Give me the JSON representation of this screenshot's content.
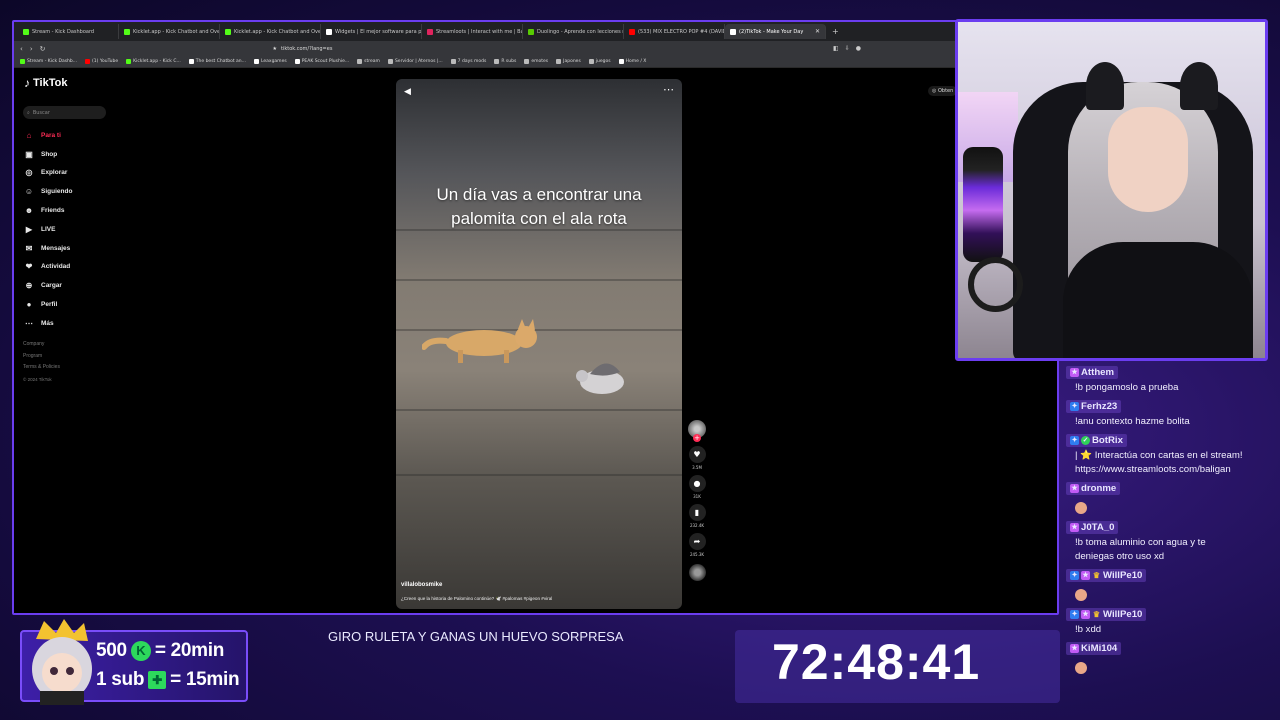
{
  "browser": {
    "tabs": [
      {
        "title": "Stream - Kick Dashboard",
        "color": "#53fc18"
      },
      {
        "title": "Kicklet.app - Kick Chatbot and Overla",
        "color": "#53fc18"
      },
      {
        "title": "Kicklet.app - Kick Chatbot and Overl",
        "color": "#53fc18"
      },
      {
        "title": "Widgets | El mejor software para por",
        "color": "#ffffff"
      },
      {
        "title": "Streamloots | Interact with me | Balig",
        "color": "#e0245e"
      },
      {
        "title": "Duolingo - Aprende con lecciones m",
        "color": "#58cc02"
      },
      {
        "title": "(533) MIX ELECTRO POP #4 (DAVID",
        "color": "#ff0000"
      },
      {
        "title": "(2)TikTok - Make Your Day",
        "color": "#ffffff"
      }
    ],
    "url": "tiktok.com/?lang=es",
    "bookmarks": [
      "Stream - Kick Dashb...",
      "(1) YouTube",
      "Kicklet.app - Kick C...",
      "The best Chatbot an...",
      "Leaxgames",
      "PEAK Scout Plushie...",
      "stream",
      "Servidor | Aternos |...",
      "7 days mods",
      "R subs",
      "emotes",
      "Japones",
      "juegos",
      "Home / X"
    ]
  },
  "tiktok": {
    "logo": "TikTok",
    "search_placeholder": "Buscar",
    "nav": [
      "Para ti",
      "Shop",
      "Explorar",
      "Siguiendo",
      "Friends",
      "LIVE",
      "Mensajes",
      "Actividad",
      "Cargar",
      "Perfil",
      "Más"
    ],
    "footer": [
      "Company",
      "Program",
      "Terms & Policies",
      "© 2024 TikTok"
    ],
    "get_app": "Obten",
    "video": {
      "caption": "Un día vas a encontrar una\npalomita con el ala rota",
      "author": "villalobosmike",
      "description": "¿Creen que la historia de Palomino continúe? 🕊️ #palomas #pigeon #viral",
      "likes": "3.5M",
      "comments": "31K",
      "saves": "232.4K",
      "shares": "245.3K"
    }
  },
  "chat": [
    {
      "user": "Atthem",
      "badges": [
        "sub"
      ],
      "text": "!b pongamoslo a prueba"
    },
    {
      "user": "Ferhz23",
      "badges": [
        "vip"
      ],
      "text": "!anu contexto hazme bolita"
    },
    {
      "user": "BotRix",
      "badges": [
        "vip",
        "bot"
      ],
      "text": "| ⭐ Interactúa con cartas en el stream!\nhttps://www.streamloots.com/baligan"
    },
    {
      "user": "dronme",
      "badges": [
        "sub"
      ],
      "text": "",
      "emote": true
    },
    {
      "user": "J0TA_0",
      "badges": [
        "sub"
      ],
      "text": "!b toma aluminio con agua y te\ndeniegas otro uso xd"
    },
    {
      "user": "WillPe10",
      "badges": [
        "vip",
        "sub",
        "crown"
      ],
      "text": "",
      "emote": true
    },
    {
      "user": "WillPe10",
      "badges": [
        "vip",
        "sub",
        "crown"
      ],
      "text": "!b xdd"
    },
    {
      "user": "KiMi104",
      "badges": [
        "sub"
      ],
      "text": "",
      "emote": true
    }
  ],
  "overlay": {
    "goal1_amount": "500",
    "goal1_result": "= 20min",
    "goal2_amount": "1 sub",
    "goal2_result": "= 15min",
    "ticker": "GIRO RULETA Y GANAS UN HUEVO SORPRESA",
    "timer": "72:48:41"
  }
}
